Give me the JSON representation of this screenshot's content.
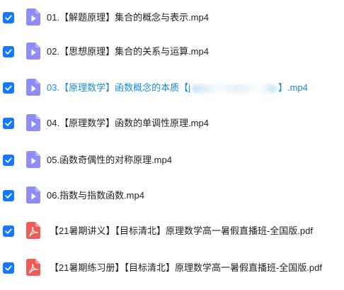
{
  "files": [
    {
      "name": "01.【解题原理】集合的概念与表示.mp4",
      "type": "video",
      "checked": true
    },
    {
      "name": "02.【思想原理】集合的关系与运算.mp4",
      "type": "video",
      "checked": true
    },
    {
      "name_prefix": "03.【原理数学】函数概念的本质【j",
      "name_suffix": "】.mp4",
      "type": "video",
      "checked": true,
      "highlighted": true
    },
    {
      "name": "04.【原理数学】函数的单调性原理.mp4",
      "type": "video",
      "checked": true
    },
    {
      "name": "05.函数奇偶性的对称原理.mp4",
      "type": "video",
      "checked": true
    },
    {
      "name": "06.指数与指数函数.mp4",
      "type": "video",
      "checked": true
    },
    {
      "name": "【21暑期讲义】【目标清北】原理数学高一暑假直播班-全国版.pdf",
      "type": "pdf",
      "checked": true
    },
    {
      "name": "【21暑期练习册】【目标清北】原理数学高一暑假直播班-全国版.pdf",
      "type": "pdf",
      "checked": true
    }
  ],
  "colors": {
    "checkbox": "#1677ff",
    "video_icon": "#8f8df5",
    "pdf_icon": "#f25c54",
    "highlight_text": "#1a8bd8"
  },
  "icons": {
    "checkbox": "checkmark-icon",
    "video": "video-file-icon",
    "pdf": "pdf-file-icon"
  }
}
